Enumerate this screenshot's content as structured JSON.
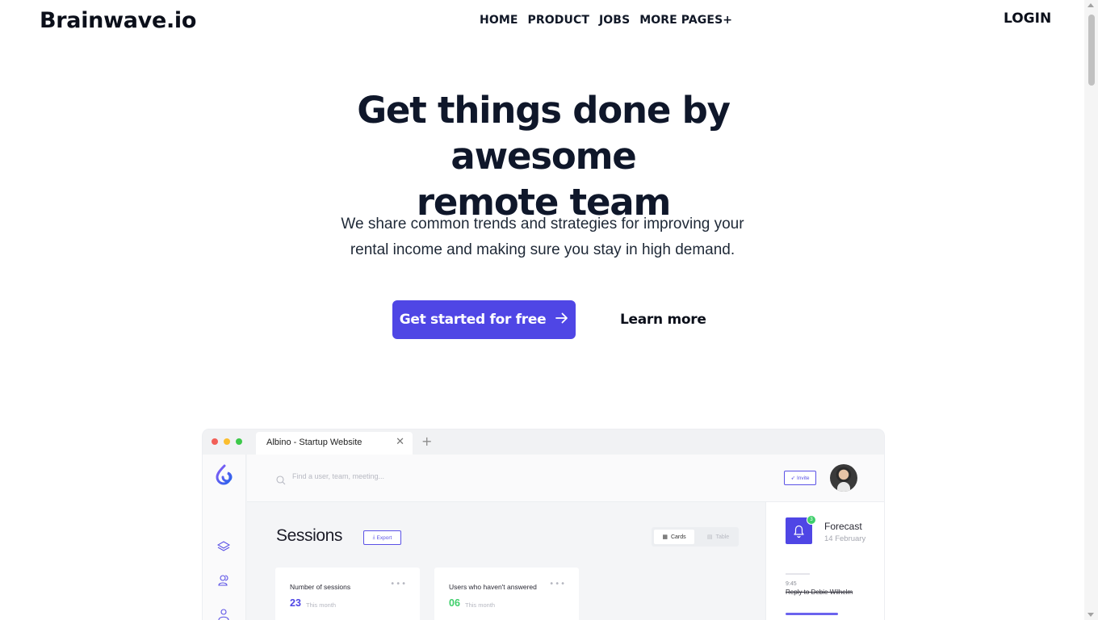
{
  "header": {
    "logo": "Brainwave.io",
    "nav": [
      "HOME",
      "PRODUCT",
      "JOBS",
      "MORE PAGES+"
    ],
    "login": "LOGIN"
  },
  "hero": {
    "title_line1": "Get things done by awesome",
    "title_line2": "remote team",
    "subtitle_line1": "We share common trends and strategies for improving your",
    "subtitle_line2": "rental income and making sure you stay in high demand.",
    "cta_label": "Get started for free",
    "learn_label": "Learn more"
  },
  "mockup": {
    "tab_title": "Albino - Startup Website",
    "tab_plus": "+",
    "search_placeholder": "Find a user, team, meeting...",
    "invite_label": "Invite",
    "sessions_title": "Sessions",
    "export_label": "Export",
    "view_cards": "Cards",
    "view_table": "Table",
    "cards": [
      {
        "title": "Number of sessions",
        "value": "23",
        "note": "This month",
        "color": "#4f46e5"
      },
      {
        "title": "Users  who haven't answered",
        "value": "06",
        "note": "This month",
        "color": "#3ecf6b"
      }
    ],
    "notification_count": "3",
    "forecast_title": "Forecast",
    "forecast_date": "14 February",
    "task_time": "9:45",
    "task_text": "Reply to Debie Wilhelm"
  },
  "colors": {
    "accent": "#4f46e5",
    "success": "#3ecf6b",
    "window_red": "#f25f58",
    "window_yellow": "#fbbe2f",
    "window_green": "#3dc94a"
  }
}
